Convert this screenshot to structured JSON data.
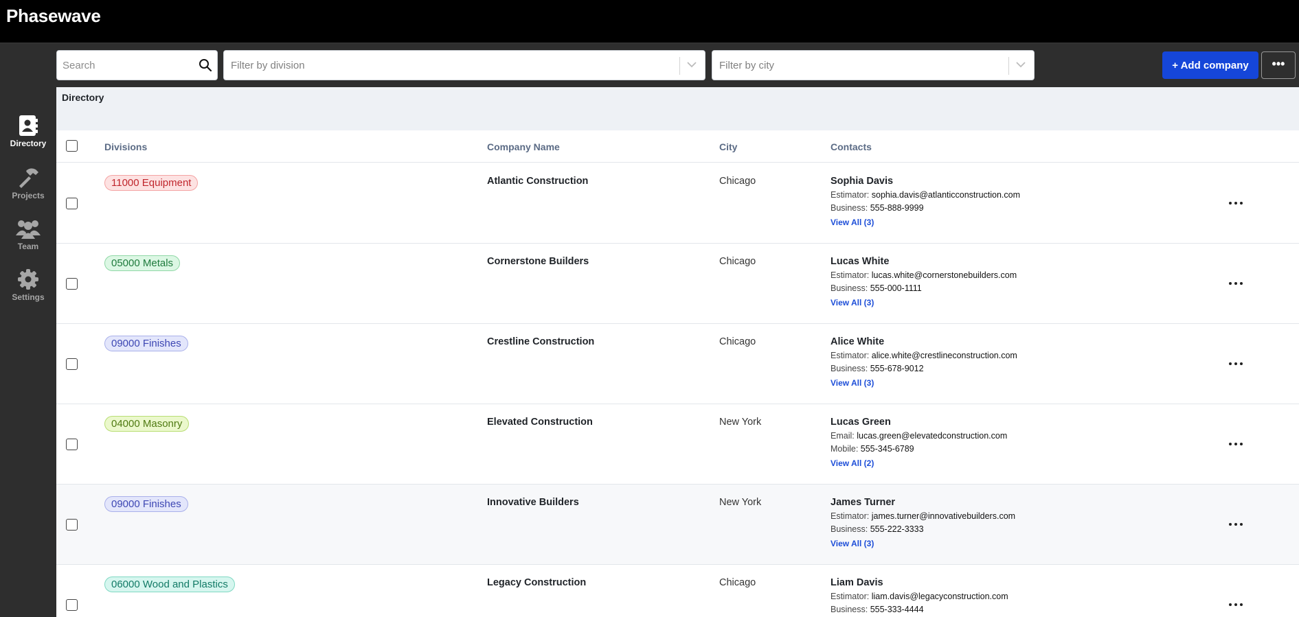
{
  "app": {
    "brand": "Phasewave"
  },
  "nav": [
    {
      "label": "Directory",
      "icon": "address-book-icon",
      "active": true
    },
    {
      "label": "Projects",
      "icon": "hammer-icon",
      "active": false
    },
    {
      "label": "Team",
      "icon": "team-icon",
      "active": false
    },
    {
      "label": "Settings",
      "icon": "gear-icon",
      "active": false
    }
  ],
  "toolbar": {
    "search_placeholder": "Search",
    "division_placeholder": "Filter by division",
    "city_placeholder": "Filter by city",
    "add_label": "+ Add company",
    "more_label": "•••"
  },
  "section": {
    "title": "Directory"
  },
  "columns": {
    "divisions": "Divisions",
    "company": "Company Name",
    "city": "City",
    "contacts": "Contacts"
  },
  "colors": {
    "accent": "#1546d9",
    "link": "#1d4ed8"
  },
  "rows": [
    {
      "division": "11000 Equipment",
      "badge": {
        "bg": "#fde2e2",
        "border": "#f4a3a3",
        "fg": "#c0262d"
      },
      "company": "Atlantic Construction",
      "city": "Chicago",
      "contact_name": "Sophia Davis",
      "line1_label": "Estimator:",
      "line1_value": "sophia.davis@atlanticconstruction.com",
      "line2_label": "Business:",
      "line2_value": "555-888-9999",
      "view_all": "View All (3)"
    },
    {
      "division": "05000 Metals",
      "badge": {
        "bg": "#dcf7e4",
        "border": "#8fd8a6",
        "fg": "#1e7a3c"
      },
      "company": "Cornerstone Builders",
      "city": "Chicago",
      "contact_name": "Lucas White",
      "line1_label": "Estimator:",
      "line1_value": "lucas.white@cornerstonebuilders.com",
      "line2_label": "Business:",
      "line2_value": "555-000-1111",
      "view_all": "View All (3)"
    },
    {
      "division": "09000 Finishes",
      "badge": {
        "bg": "#e3e6fb",
        "border": "#a9b0ea",
        "fg": "#3d47b3"
      },
      "company": "Crestline Construction",
      "city": "Chicago",
      "contact_name": "Alice White",
      "line1_label": "Estimator:",
      "line1_value": "alice.white@crestlineconstruction.com",
      "line2_label": "Business:",
      "line2_value": "555-678-9012",
      "view_all": "View All (3)"
    },
    {
      "division": "04000 Masonry",
      "badge": {
        "bg": "#ebf8cc",
        "border": "#b8dd73",
        "fg": "#4f7a12"
      },
      "company": "Elevated Construction",
      "city": "New York",
      "contact_name": "Lucas Green",
      "line1_label": "Email:",
      "line1_value": "lucas.green@elevatedconstruction.com",
      "line2_label": "Mobile:",
      "line2_value": "555-345-6789",
      "view_all": "View All (2)"
    },
    {
      "division": "09000 Finishes",
      "badge": {
        "bg": "#e3e6fb",
        "border": "#a9b0ea",
        "fg": "#3d47b3"
      },
      "company": "Innovative Builders",
      "city": "New York",
      "contact_name": "James Turner",
      "line1_label": "Estimator:",
      "line1_value": "james.turner@innovativebuilders.com",
      "line2_label": "Business:",
      "line2_value": "555-222-3333",
      "view_all": "View All (3)"
    },
    {
      "division": "06000 Wood and Plastics",
      "badge": {
        "bg": "#d6f6ef",
        "border": "#7fd8c2",
        "fg": "#127a66"
      },
      "company": "Legacy Construction",
      "city": "Chicago",
      "contact_name": "Liam Davis",
      "line1_label": "Estimator:",
      "line1_value": "liam.davis@legacyconstruction.com",
      "line2_label": "Business:",
      "line2_value": "555-333-4444",
      "view_all": "View All (3)"
    }
  ]
}
